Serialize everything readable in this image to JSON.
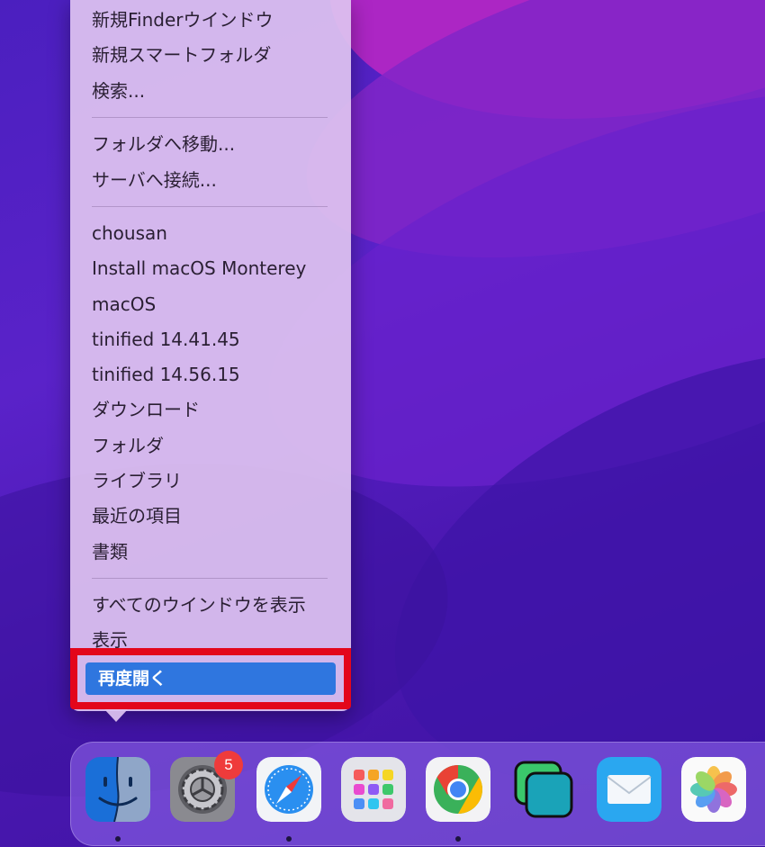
{
  "menu": {
    "section1": [
      "新規Finderウインドウ",
      "新規スマートフォルダ",
      "検索..."
    ],
    "section2": [
      "フォルダへ移動...",
      "サーバへ接続..."
    ],
    "section3": [
      "chousan",
      "Install macOS Monterey",
      "macOS",
      "tinified 14.41.45",
      "tinified 14.56.15",
      "ダウンロード",
      "フォルダ",
      "ライブラリ",
      "最近の項目",
      "書類"
    ],
    "section4": [
      "すべてのウインドウを表示",
      "表示"
    ],
    "selected": "再度開く"
  },
  "dock": {
    "apps": [
      {
        "name": "finder-icon",
        "running": true
      },
      {
        "name": "system-preferences-icon",
        "running": false,
        "badge": "5"
      },
      {
        "name": "safari-icon",
        "running": true
      },
      {
        "name": "launchpad-icon",
        "running": false
      },
      {
        "name": "chrome-icon",
        "running": true
      },
      {
        "name": "screen-sharing-icon",
        "running": false
      },
      {
        "name": "mail-icon",
        "running": false
      },
      {
        "name": "photos-icon",
        "running": false
      }
    ]
  },
  "colors": {
    "highlight_frame": "#e3061b",
    "selection": "#2f76df",
    "menu_bg": "#dec3f0"
  }
}
